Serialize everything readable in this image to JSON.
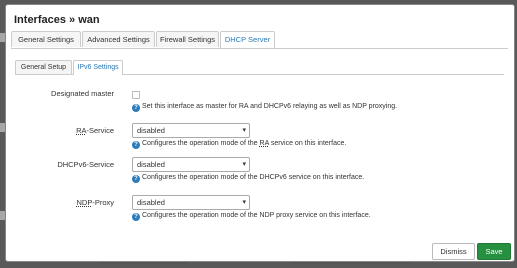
{
  "modal": {
    "title": "Interfaces » wan"
  },
  "main_tabs": [
    {
      "label": "General Settings",
      "active": false
    },
    {
      "label": "Advanced Settings",
      "active": false
    },
    {
      "label": "Firewall Settings",
      "active": false
    },
    {
      "label": "DHCP Server",
      "active": true
    }
  ],
  "sub_tabs": [
    {
      "label": "General Setup",
      "active": false
    },
    {
      "label": "IPv6 Settings",
      "active": true
    }
  ],
  "fields": {
    "designated_master": {
      "label": "Designated master",
      "checked": false,
      "help": "Set this interface as master for RA and DHCPv6 relaying as well as NDP proxying."
    },
    "ra_service": {
      "label_abbr": "RA",
      "label_rest": "-Service",
      "value": "disabled",
      "help_pre": "Configures the operation mode of the ",
      "help_abbr": "RA",
      "help_post": " service on this interface."
    },
    "dhcpv6_service": {
      "label": "DHCPv6-Service",
      "value": "disabled",
      "help": "Configures the operation mode of the DHCPv6 service on this interface."
    },
    "ndp_proxy": {
      "label_abbr": "NDP",
      "label_rest": "-Proxy",
      "value": "disabled",
      "help": "Configures the operation mode of the NDP proxy service on this interface."
    }
  },
  "buttons": {
    "dismiss": "Dismiss",
    "save": "Save"
  },
  "icons": {
    "help": "help-circle-icon",
    "caret": "chevron-down-icon"
  },
  "colors": {
    "accent": "#2a7bb8",
    "save": "#25903f",
    "overlay": "#595959"
  }
}
